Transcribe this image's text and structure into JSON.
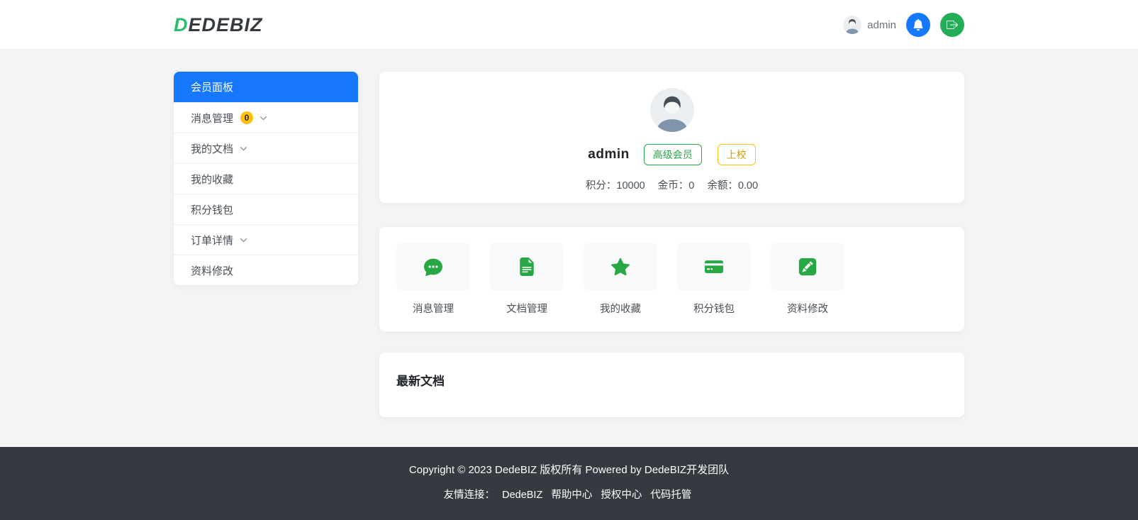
{
  "header": {
    "logo_first": "D",
    "logo_rest": "EDEBIZ",
    "username": "admin"
  },
  "sidebar": {
    "items": [
      {
        "key": "dashboard",
        "label": "会员面板",
        "active": true
      },
      {
        "key": "messages",
        "label": "消息管理",
        "badge": "0",
        "chevron": true
      },
      {
        "key": "documents",
        "label": "我的文档",
        "chevron": true
      },
      {
        "key": "favorites",
        "label": "我的收藏"
      },
      {
        "key": "wallet",
        "label": "积分钱包"
      },
      {
        "key": "orders",
        "label": "订单详情",
        "chevron": true
      },
      {
        "key": "profile",
        "label": "资料修改"
      }
    ]
  },
  "profile": {
    "username": "admin",
    "badges": [
      {
        "label": "高级会员",
        "style": "green"
      },
      {
        "label": "上校",
        "style": "yellow"
      }
    ],
    "stats": [
      {
        "label": "积分：",
        "value": "10000"
      },
      {
        "label": "金币：",
        "value": "0"
      },
      {
        "label": "余额：",
        "value": "0.00"
      }
    ]
  },
  "quick_actions": [
    {
      "key": "messages",
      "label": "消息管理",
      "icon": "chat-icon"
    },
    {
      "key": "documents",
      "label": "文档管理",
      "icon": "document-icon"
    },
    {
      "key": "favorites",
      "label": "我的收藏",
      "icon": "star-icon"
    },
    {
      "key": "wallet",
      "label": "积分钱包",
      "icon": "credit-card-icon"
    },
    {
      "key": "profile",
      "label": "资料修改",
      "icon": "edit-icon"
    }
  ],
  "latest_docs": {
    "title": "最新文档"
  },
  "footer": {
    "copyright": "Copyright © 2023 DedeBIZ 版权所有 Powered by DedeBIZ开发团队",
    "links_label": "友情连接：",
    "links": [
      "DedeBIZ",
      "帮助中心",
      "授权中心",
      "代码托管"
    ]
  },
  "colors": {
    "primary_blue": "#1677ff",
    "brand_green": "#28a745",
    "logo_green": "#2bbd6e",
    "badge_yellow": "#ffc107",
    "footer_dark": "#343a40"
  }
}
